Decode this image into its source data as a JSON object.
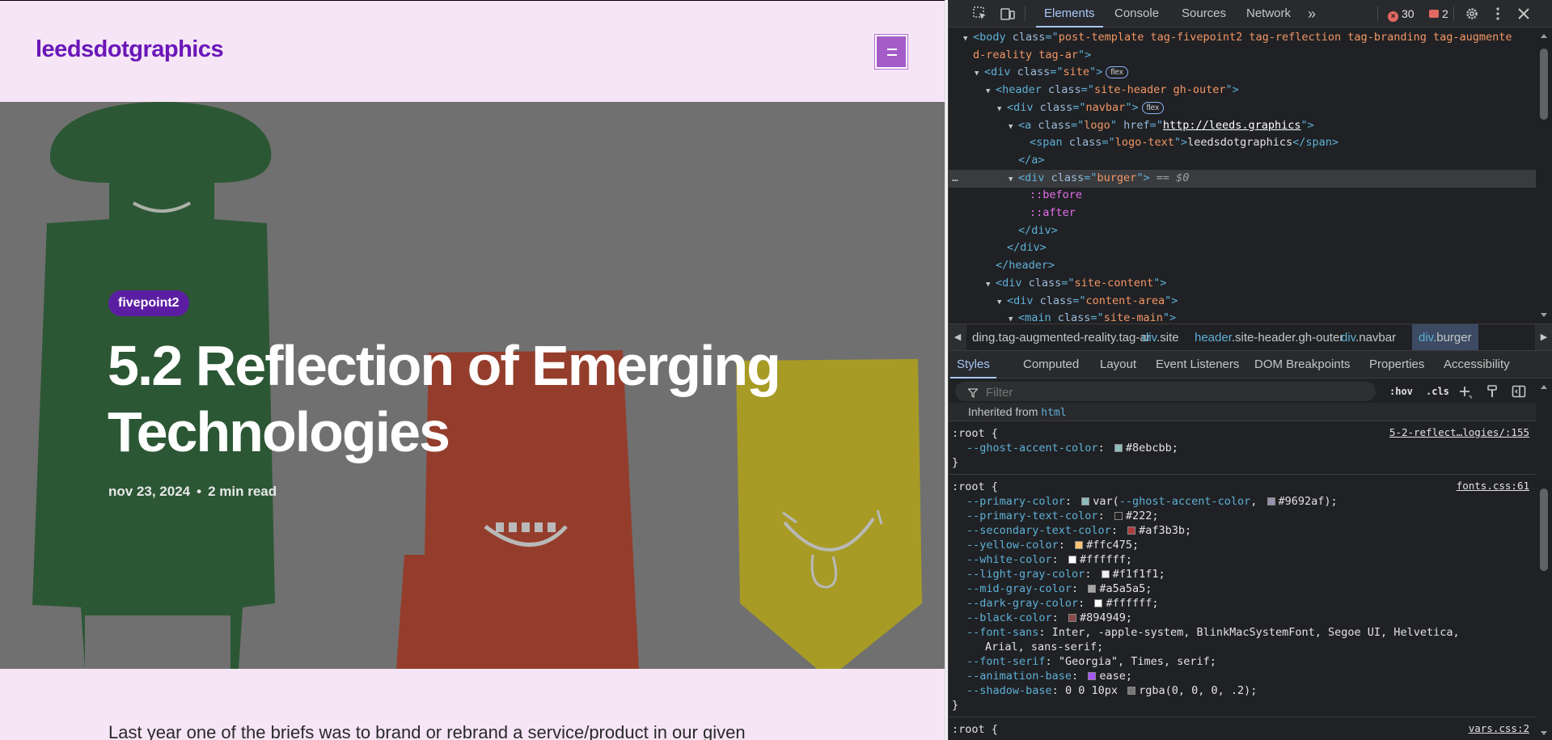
{
  "page": {
    "logo_text": "leedsdotgraphics",
    "tag": "fivepoint2",
    "title": "5.2 Reflection of Emerging Technologies",
    "date": "nov 23, 2024",
    "meta_separator": "•",
    "read_time": "2 min read",
    "excerpt": "Last year one of the briefs was to brand or rebrand a service/product in our given"
  },
  "colors": {
    "page_bg": "#f6e5f6",
    "logo": "#6a16b8",
    "burger": "#a55cc8",
    "tag_pill": "#5b1ea3",
    "hero_green": "#2f6a3a",
    "hero_red": "#c0462e",
    "hero_yellow": "#d9c826"
  },
  "devtools": {
    "tabs": [
      "Elements",
      "Console",
      "Sources",
      "Network"
    ],
    "more_tabs": "»",
    "error_count": "30",
    "issue_count": "2",
    "dom": [
      {
        "indent": 1,
        "tri": "▼",
        "parts": [
          [
            "tag",
            "<body "
          ],
          [
            "attr",
            "class"
          ],
          [
            "tag",
            "=\""
          ],
          [
            "val",
            "post-template tag-fivepoint2 tag-reflection tag-branding tag-augmente"
          ]
        ]
      },
      {
        "indent": 1,
        "tri": "",
        "parts": [
          [
            "val",
            "d-reality tag-ar"
          ],
          [
            "tag",
            "\">"
          ]
        ]
      },
      {
        "indent": 2,
        "tri": "▼",
        "parts": [
          [
            "tag",
            "<div "
          ],
          [
            "attr",
            "class"
          ],
          [
            "tag",
            "=\""
          ],
          [
            "val",
            "site"
          ],
          [
            "tag",
            "\">"
          ]
        ],
        "badge": "flex"
      },
      {
        "indent": 3,
        "tri": "▼",
        "parts": [
          [
            "tag",
            "<header "
          ],
          [
            "attr",
            "class"
          ],
          [
            "tag",
            "=\""
          ],
          [
            "val",
            "site-header gh-outer"
          ],
          [
            "tag",
            "\">"
          ]
        ]
      },
      {
        "indent": 4,
        "tri": "▼",
        "parts": [
          [
            "tag",
            "<div "
          ],
          [
            "attr",
            "class"
          ],
          [
            "tag",
            "=\""
          ],
          [
            "val",
            "navbar"
          ],
          [
            "tag",
            "\">"
          ]
        ],
        "badge": "flex"
      },
      {
        "indent": 5,
        "tri": "▼",
        "parts": [
          [
            "tag",
            "<a "
          ],
          [
            "attr",
            "class"
          ],
          [
            "tag",
            "=\""
          ],
          [
            "val",
            "logo"
          ],
          [
            "tag",
            "\" "
          ],
          [
            "attr",
            "href"
          ],
          [
            "tag",
            "=\""
          ],
          [
            "link",
            "http://leeds.graphics"
          ],
          [
            "tag",
            "\">"
          ]
        ]
      },
      {
        "indent": 6,
        "tri": "",
        "parts": [
          [
            "tag",
            "<span "
          ],
          [
            "attr",
            "class"
          ],
          [
            "tag",
            "=\""
          ],
          [
            "val",
            "logo-text"
          ],
          [
            "tag",
            "\">"
          ],
          [
            "text",
            "leedsdotgraphics"
          ],
          [
            "tag",
            "</span>"
          ]
        ]
      },
      {
        "indent": 5,
        "tri": "",
        "parts": [
          [
            "tag",
            "</a>"
          ]
        ]
      },
      {
        "indent": 5,
        "tri": "▼",
        "parts": [
          [
            "tag",
            "<div "
          ],
          [
            "attr",
            "class"
          ],
          [
            "tag",
            "=\""
          ],
          [
            "val",
            "burger"
          ],
          [
            "tag",
            "\">"
          ],
          [
            "eq",
            " == $0"
          ]
        ],
        "selected": true
      },
      {
        "indent": 6,
        "tri": "",
        "parts": [
          [
            "pseudo",
            "::before"
          ]
        ]
      },
      {
        "indent": 6,
        "tri": "",
        "parts": [
          [
            "pseudo",
            "::after"
          ]
        ]
      },
      {
        "indent": 5,
        "tri": "",
        "parts": [
          [
            "tag",
            "</div>"
          ]
        ]
      },
      {
        "indent": 4,
        "tri": "",
        "parts": [
          [
            "tag",
            "</div>"
          ]
        ]
      },
      {
        "indent": 3,
        "tri": "",
        "parts": [
          [
            "tag",
            "</header>"
          ]
        ]
      },
      {
        "indent": 3,
        "tri": "▼",
        "parts": [
          [
            "tag",
            "<div "
          ],
          [
            "attr",
            "class"
          ],
          [
            "tag",
            "=\""
          ],
          [
            "val",
            "site-content"
          ],
          [
            "tag",
            "\">"
          ]
        ]
      },
      {
        "indent": 4,
        "tri": "▼",
        "parts": [
          [
            "tag",
            "<div "
          ],
          [
            "attr",
            "class"
          ],
          [
            "tag",
            "=\""
          ],
          [
            "val",
            "content-area"
          ],
          [
            "tag",
            "\">"
          ]
        ]
      },
      {
        "indent": 5,
        "tri": "▼",
        "parts": [
          [
            "tag",
            "<main "
          ],
          [
            "attr",
            "class"
          ],
          [
            "tag",
            "=\""
          ],
          [
            "val",
            "site-main"
          ],
          [
            "tag",
            "\">"
          ]
        ]
      }
    ],
    "ellipsis": "…",
    "breadcrumbs": [
      {
        "tag": "",
        "rest": "ding.tag-augmented-reality.tag-ar"
      },
      {
        "tag": "div",
        "rest": ".site"
      },
      {
        "tag": "header",
        "rest": ".site-header.gh-outer"
      },
      {
        "tag": "div",
        "rest": ".navbar"
      },
      {
        "tag": "div",
        "rest": ".burger",
        "selected": true
      }
    ],
    "sub_tabs": [
      "Styles",
      "Computed",
      "Layout",
      "Event Listeners",
      "DOM Breakpoints",
      "Properties",
      "Accessibility"
    ],
    "filter_placeholder": "Filter",
    "hov_label": ":hov",
    "cls_label": ".cls",
    "inherited_prefix": "Inherited from",
    "inherited_from": "html",
    "rules": [
      {
        "selector": ":root {",
        "source": "5-2-reflect…logies/:155",
        "props": [
          {
            "name": "--ghost-accent-color",
            "value": "#8ebcbb",
            "swatch": "#8ebcbb"
          }
        ]
      },
      {
        "selector": ":root {",
        "source": "fonts.css:61",
        "props": [
          {
            "name": "--primary-color",
            "value": "var(--ghost-accent-color, ",
            "swatch": "#8ebcbb",
            "value2": "#9692af);",
            "swatch2": "#9692af"
          },
          {
            "name": "--primary-text-color",
            "value": "#222",
            "swatch": "#222222"
          },
          {
            "name": "--secondary-text-color",
            "value": "#af3b3b",
            "swatch": "#af3b3b"
          },
          {
            "name": "--yellow-color",
            "value": "#ffc475",
            "swatch": "#ffc475"
          },
          {
            "name": "--white-color",
            "value": "#ffffff",
            "swatch": "#ffffff"
          },
          {
            "name": "--light-gray-color",
            "value": "#f1f1f1",
            "swatch": "#f1f1f1"
          },
          {
            "name": "--mid-gray-color",
            "value": "#a5a5a5",
            "swatch": "#a5a5a5"
          },
          {
            "name": "--dark-gray-color",
            "value": "#ffffff",
            "swatch": "#ffffff"
          },
          {
            "name": "--black-color",
            "value": "#894949",
            "swatch": "#894949"
          },
          {
            "name": "--font-sans",
            "value": "Inter, -apple-system, BlinkMacSystemFont, Segoe UI, Helvetica,"
          },
          {
            "name": "",
            "value": "Arial, sans-serif;",
            "continuation": true
          },
          {
            "name": "--font-serif",
            "value": "\"Georgia\", Times, serif"
          },
          {
            "name": "--animation-base",
            "value": "ease",
            "swatch": "#a855f7"
          },
          {
            "name": "--shadow-base",
            "value": "0 0 10px ",
            "swatch": "#777777",
            "value2": "rgba(0, 0, 0, .2);"
          }
        ]
      },
      {
        "selector": ":root {",
        "source": "vars.css:2",
        "props": []
      }
    ]
  }
}
